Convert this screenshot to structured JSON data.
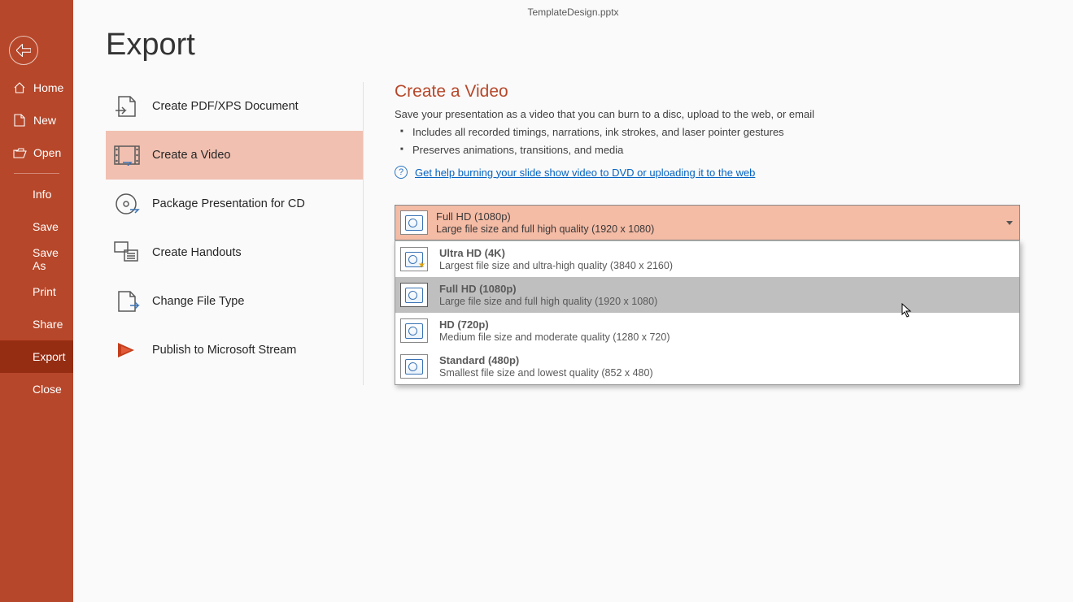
{
  "document_title": "TemplateDesign.pptx",
  "page_heading": "Export",
  "sidebar": {
    "home": "Home",
    "new": "New",
    "open": "Open",
    "info": "Info",
    "save": "Save",
    "saveas": "Save As",
    "print": "Print",
    "share": "Share",
    "export": "Export",
    "close": "Close"
  },
  "export_options": {
    "pdf": "Create PDF/XPS Document",
    "video": "Create a Video",
    "cd": "Package Presentation for CD",
    "handouts": "Create Handouts",
    "filetype": "Change File Type",
    "stream": "Publish to Microsoft Stream"
  },
  "detail": {
    "heading": "Create a Video",
    "desc": "Save your presentation as a video that you can burn to a disc, upload to the web, or email",
    "b1": "Includes all recorded timings, narrations, ink strokes, and laser pointer gestures",
    "b2": "Preserves animations, transitions, and media",
    "help_link": "Get help burning your slide show video to DVD or uploading it to the web"
  },
  "quality_selected": {
    "title": "Full HD (1080p)",
    "sub": "Large file size and full high quality (1920 x 1080)"
  },
  "quality_options": [
    {
      "title": "Ultra HD (4K)",
      "sub": "Largest file size and ultra-high quality (3840 x 2160)"
    },
    {
      "title": "Full HD (1080p)",
      "sub": "Large file size and full high quality (1920 x 1080)"
    },
    {
      "title": "HD (720p)",
      "sub": "Medium file size and moderate quality (1280 x 720)"
    },
    {
      "title": "Standard (480p)",
      "sub": "Smallest file size and lowest quality (852 x 480)"
    }
  ]
}
